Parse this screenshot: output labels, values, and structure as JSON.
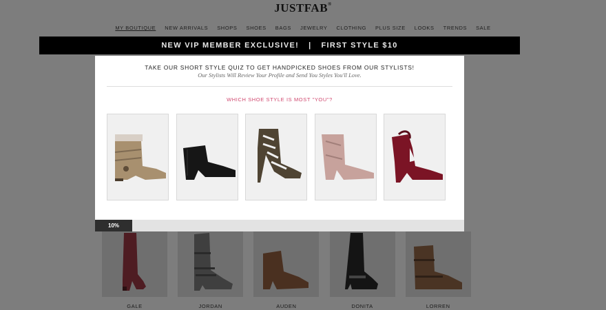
{
  "brand": {
    "name": "JUSTFAB",
    "mark": "®"
  },
  "nav": [
    "MY BOUTIQUE",
    "NEW ARRIVALS",
    "SHOPS",
    "SHOES",
    "BAGS",
    "JEWELRY",
    "CLOTHING",
    "PLUS SIZE",
    "LOOKS",
    "TRENDS",
    "SALE"
  ],
  "banner": {
    "left": "NEW VIP MEMBER EXCLUSIVE!",
    "separator": "|",
    "right": "FIRST STYLE $10"
  },
  "quiz": {
    "title": "TAKE OUR SHORT STYLE QUIZ TO GET HANDPICKED SHOES FROM OUR STYLISTS!",
    "subtitle": "Our Stylists Will Review Your Profile and Send You Styles You'll Love.",
    "question": "WHICH SHOE STYLE IS MOST \"YOU\"?",
    "options": [
      {
        "icon": "slouch-boot-tan-icon"
      },
      {
        "icon": "ankle-bootie-black-icon"
      },
      {
        "icon": "cutout-heel-olive-icon"
      },
      {
        "icon": "velvet-bootie-blush-icon"
      },
      {
        "icon": "cutout-bootie-burgundy-icon"
      }
    ],
    "progress": {
      "value": 0.1,
      "label": "10%"
    }
  },
  "products": [
    {
      "name": "GALE",
      "icon": "burgundy-otk-boot-icon"
    },
    {
      "name": "JORDAN",
      "icon": "gray-buckle-boot-icon"
    },
    {
      "name": "AUDEN",
      "icon": "brown-ankle-bootie-icon"
    },
    {
      "name": "DONITA",
      "icon": "black-riding-boot-icon"
    },
    {
      "name": "LORREN",
      "icon": "brown-moto-boot-icon"
    }
  ],
  "colors": {
    "accent": "#d0486f",
    "banner": "#000000",
    "overlay": "#7d7d7d"
  }
}
